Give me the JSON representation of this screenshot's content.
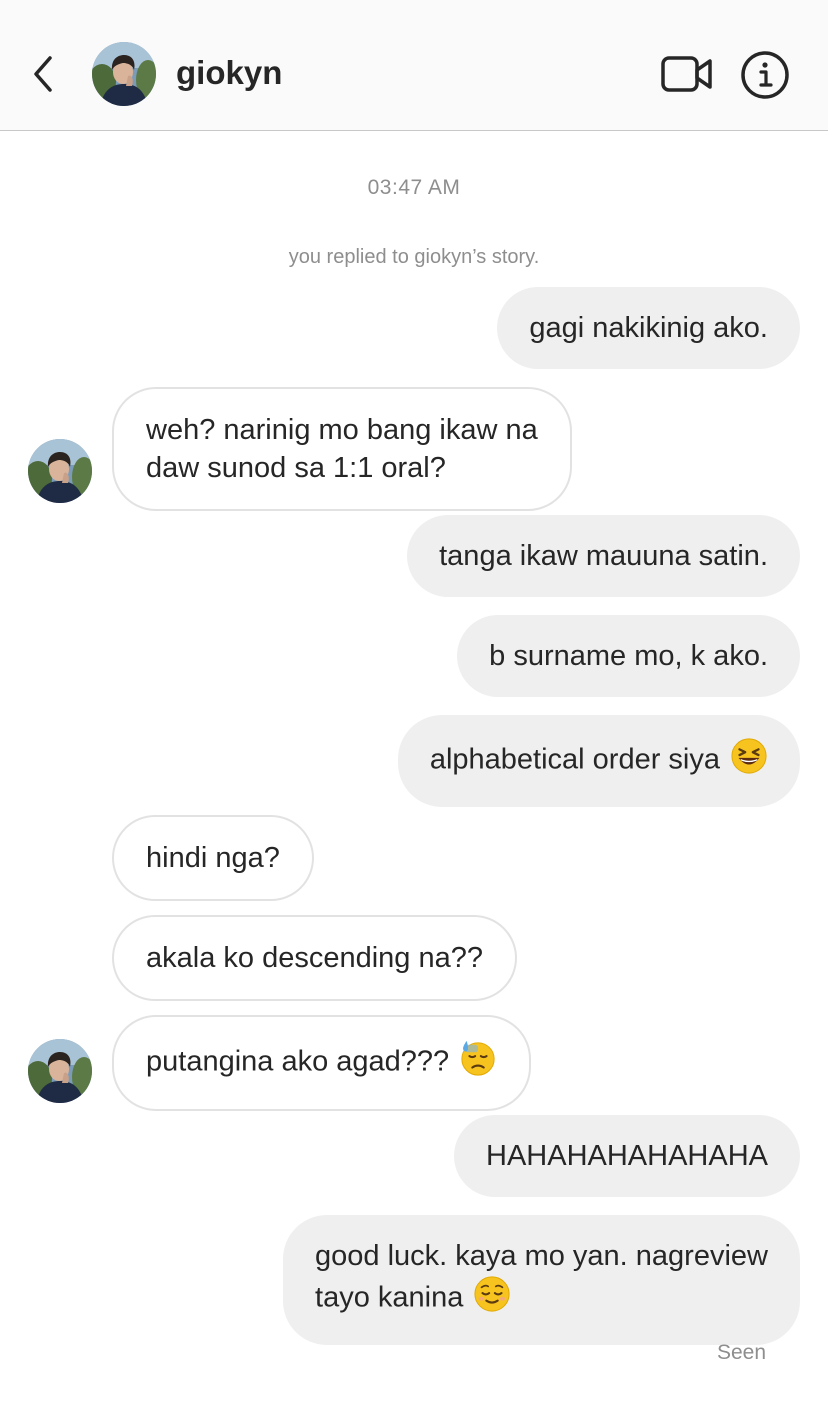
{
  "header": {
    "username": "giokyn"
  },
  "thread": {
    "timestamp": "03:47 AM",
    "story_note": "you replied to giokyn’s story.",
    "messages": [
      {
        "from": "me",
        "text": "gagi nakikinig ako."
      },
      {
        "from": "them",
        "lines": [
          "weh? narinig mo bang ikaw na",
          "daw sunod sa 1:1 oral?"
        ]
      },
      {
        "from": "me",
        "text": "tanga ikaw mauuna satin."
      },
      {
        "from": "me",
        "text": "b surname mo, k ako."
      },
      {
        "from": "me",
        "text": "alphabetical order siya",
        "emoji": "grinning-squinting-face"
      },
      {
        "from": "them",
        "text": "hindi nga?"
      },
      {
        "from": "them",
        "text": "akala ko descending na??"
      },
      {
        "from": "them",
        "text": "putangina ako agad???",
        "emoji": "downcast-face-with-sweat"
      },
      {
        "from": "me",
        "text": "HAHAHAHAHAHAHA"
      },
      {
        "from": "me",
        "lines": [
          "good luck. kaya mo yan. nagreview",
          "tayo kanina"
        ],
        "emoji": "relieved-face"
      }
    ],
    "seen_label": "Seen"
  },
  "icons": {
    "back": "chevron-left-icon",
    "video": "video-camera-icon",
    "info": "info-circle-icon"
  },
  "colors": {
    "outgoing_bubble": "#efefef",
    "incoming_border": "#e2e2e2",
    "meta_text": "#8e8e8e",
    "emoji_yellow": "#f7c31f"
  }
}
